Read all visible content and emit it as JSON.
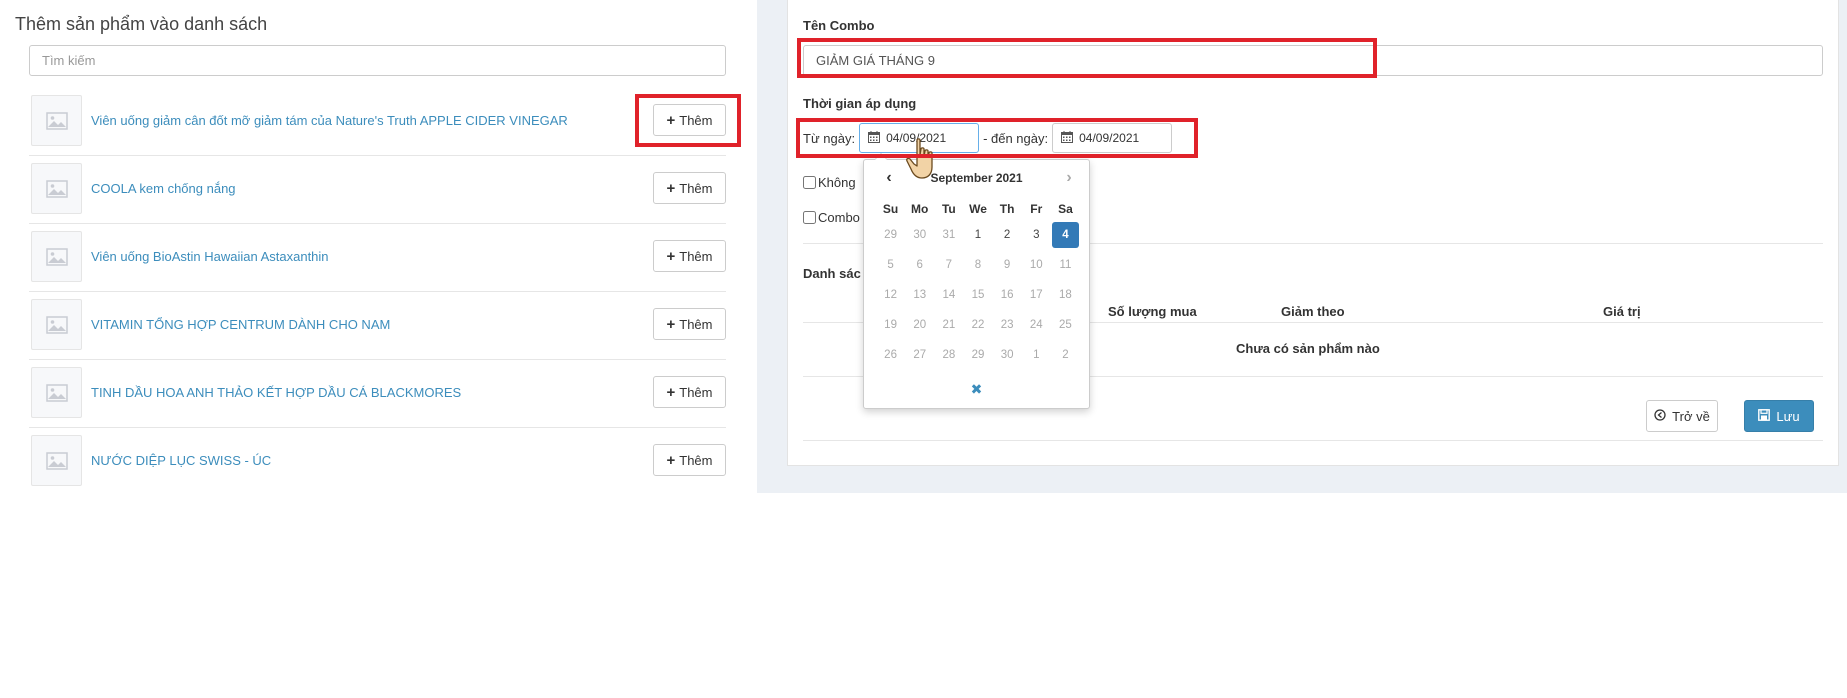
{
  "left": {
    "title": "Thêm sản phẩm vào danh sách",
    "search_placeholder": "Tìm kiếm",
    "add_label": "Thêm",
    "products": [
      "Viên uống giảm cân đốt mỡ giảm tám của Nature's Truth APPLE CIDER VINEGAR",
      "COOLA kem chống nắng",
      "Viên uống BioAstin Hawaiian Astaxanthin",
      "VITAMIN TỔNG HỢP CENTRUM DÀNH CHO NAM",
      "TINH DẦU HOA ANH THẢO KẾT HỢP DẦU CÁ BLACKMORES",
      "NƯỚC DIỆP LỤC SWISS - ÚC"
    ]
  },
  "form": {
    "combo_label": "Tên Combo",
    "combo_value": "GIẢM GIÁ THÁNG 9",
    "period_label": "Thời gian áp dụng",
    "from_label": "Từ ngày:",
    "from_value": "04/09/2021",
    "to_label": "- đến ngày:",
    "to_value": "04/09/2021",
    "check1_label": "Không",
    "check2_label": "Combo",
    "list_label": "Danh sác",
    "col_qty": "Số lượng mua",
    "col_discount_by": "Giảm theo",
    "col_value": "Giá trị",
    "empty_msg": "Chưa có sản phẩm nào",
    "back_label": "Trở về",
    "save_label": "Lưu"
  },
  "datepicker": {
    "month_title": "September 2021",
    "dow": [
      "Su",
      "Mo",
      "Tu",
      "We",
      "Th",
      "Fr",
      "Sa"
    ],
    "weeks": [
      [
        "29",
        "30",
        "31",
        "1",
        "2",
        "3",
        "4"
      ],
      [
        "5",
        "6",
        "7",
        "8",
        "9",
        "10",
        "11"
      ],
      [
        "12",
        "13",
        "14",
        "15",
        "16",
        "17",
        "18"
      ],
      [
        "19",
        "20",
        "21",
        "22",
        "23",
        "24",
        "25"
      ],
      [
        "26",
        "27",
        "28",
        "29",
        "30",
        "1",
        "2"
      ]
    ],
    "selected": "4",
    "close_glyph": "✖"
  },
  "colors": {
    "link": "#3c8dbc",
    "primary": "#3c8dbc",
    "selected_day": "#337ab7",
    "annotation": "#e0222a",
    "panel_bg": "#ecf0f5"
  }
}
